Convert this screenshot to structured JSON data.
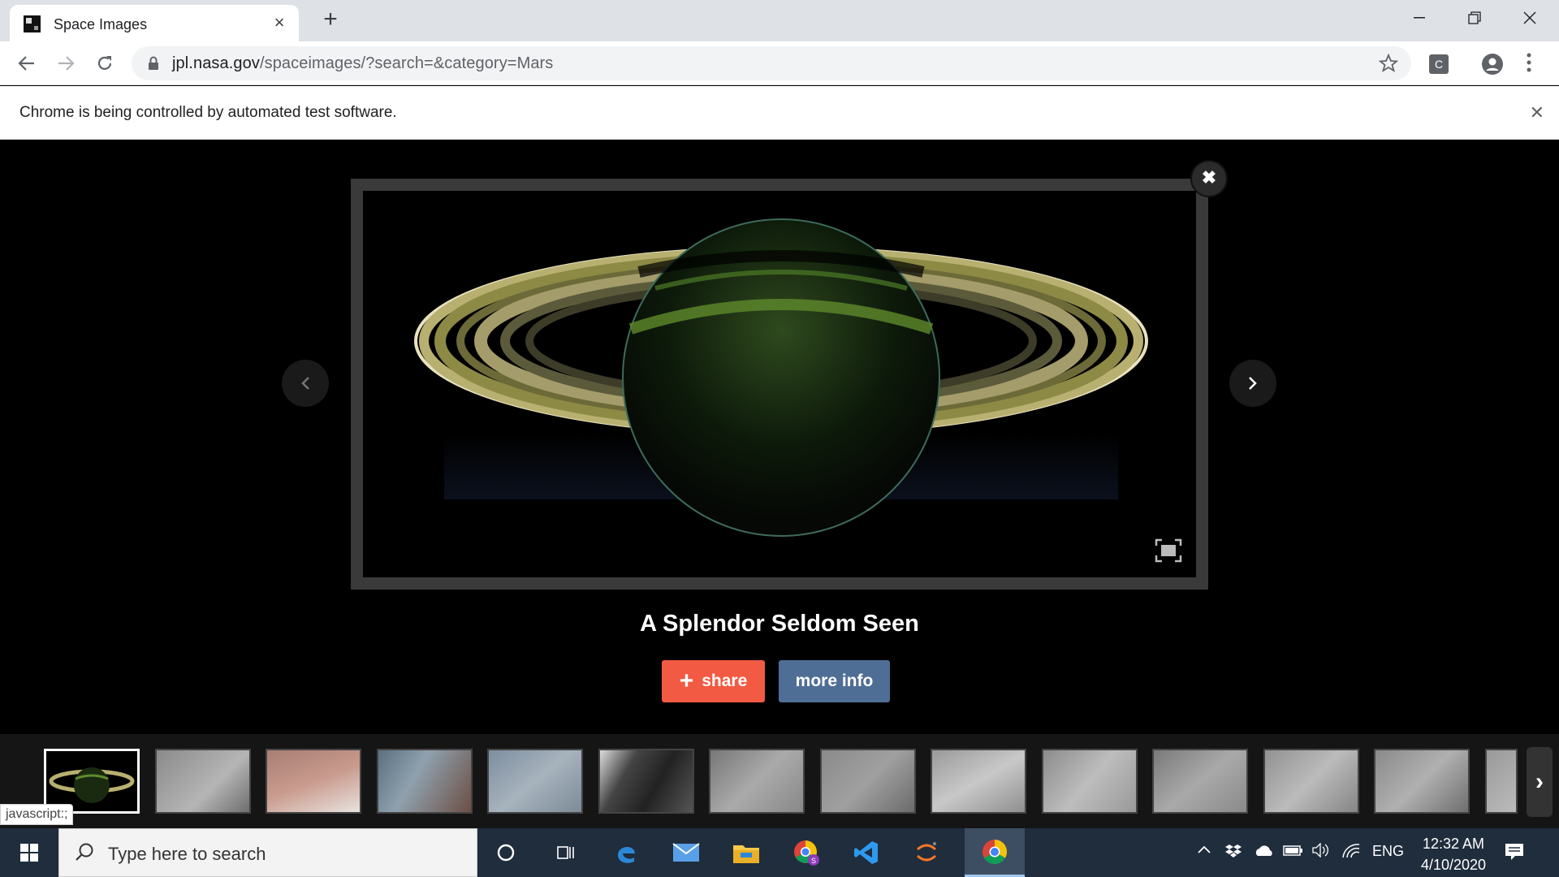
{
  "browser": {
    "tab_title": "Space Images",
    "url_domain": "jpl.nasa.gov",
    "url_path": "/spaceimages/?search=&category=Mars",
    "ext_label": "C",
    "infobar_text": "Chrome is being controlled by automated test software."
  },
  "viewer": {
    "image_title": "A Splendor Seldom Seen",
    "share_label": "share",
    "more_info_label": "more info",
    "close_glyph": "✖",
    "next_thumb_glyph": "›"
  },
  "thumbnails": [
    {
      "subject": "saturn",
      "active": true
    },
    {
      "subject": "mars-gray-terrain"
    },
    {
      "subject": "mars-pink-frost"
    },
    {
      "subject": "mars-blue-dunes"
    },
    {
      "subject": "mars-blue-rocks"
    },
    {
      "subject": "mars-dark-patch"
    },
    {
      "subject": "mars-ridges"
    },
    {
      "subject": "mars-crater"
    },
    {
      "subject": "mars-channels"
    },
    {
      "subject": "mars-flow"
    },
    {
      "subject": "mars-hills"
    },
    {
      "subject": "mars-plains"
    },
    {
      "subject": "mars-fractures"
    },
    {
      "subject": "mars-partial"
    }
  ],
  "status_url": "javascript:;",
  "taskbar": {
    "search_placeholder": "Type here to search",
    "language": "ENG",
    "time": "12:32 AM",
    "date": "4/10/2020"
  },
  "colors": {
    "share": "#f25a43",
    "more_info": "#4f6e96",
    "taskbar": "#1f2d3d"
  }
}
